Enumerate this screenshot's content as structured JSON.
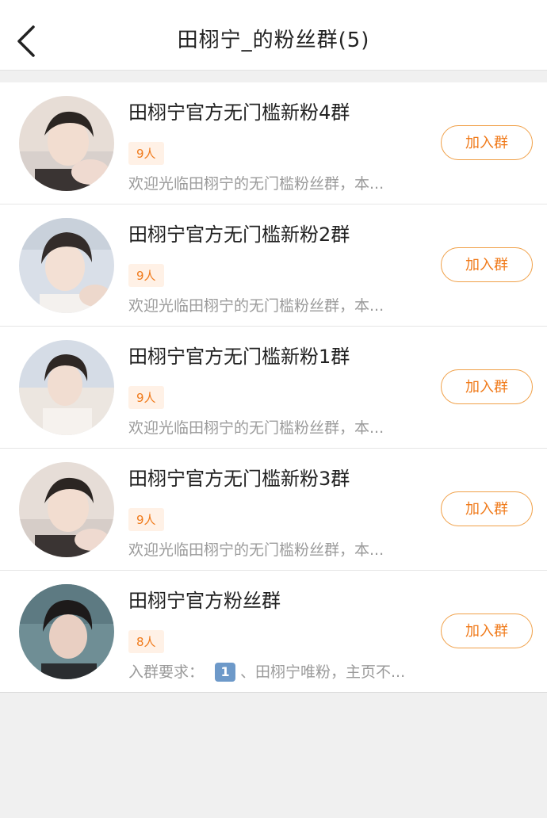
{
  "header": {
    "title": "田栩宁_的粉丝群(5)"
  },
  "groups": [
    {
      "name": "田栩宁官方无门槛新粉4群",
      "count": "9人",
      "desc": "欢迎光临田栩宁的无门槛粉丝群，本...",
      "join_label": "加入群",
      "avatar_tone": "#e7ddd6"
    },
    {
      "name": "田栩宁官方无门槛新粉2群",
      "count": "9人",
      "desc": "欢迎光临田栩宁的无门槛粉丝群，本...",
      "join_label": "加入群",
      "avatar_tone": "#d9dfe8"
    },
    {
      "name": "田栩宁官方无门槛新粉1群",
      "count": "9人",
      "desc": "欢迎光临田栩宁的无门槛粉丝群，本...",
      "join_label": "加入群",
      "avatar_tone": "#d5dce6"
    },
    {
      "name": "田栩宁官方无门槛新粉3群",
      "count": "9人",
      "desc": "欢迎光临田栩宁的无门槛粉丝群，本...",
      "join_label": "加入群",
      "avatar_tone": "#e6ddd7"
    },
    {
      "name": "田栩宁官方粉丝群",
      "count": "8人",
      "desc_prefix": "入群要求：",
      "desc_number": "1",
      "desc_rest": "、田栩宁唯粉，主页不...",
      "join_label": "加入群",
      "avatar_tone": "#6f8e95"
    }
  ],
  "colors": {
    "accent": "#f07a1a",
    "button_border": "#f0a048",
    "badge_bg": "#fff1e6",
    "page_bg": "#f0f0f0"
  },
  "icons": {
    "back": "chevron-left-icon"
  }
}
